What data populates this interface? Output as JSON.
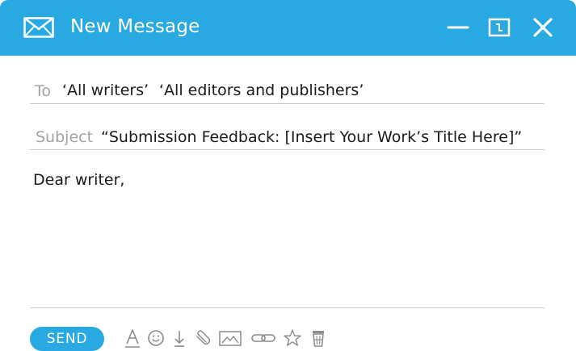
{
  "window": {
    "title": "New Message",
    "icons": [
      "envelope-icon",
      "minimize-icon",
      "maximize-icon",
      "close-icon"
    ]
  },
  "compose": {
    "to_label": "To",
    "recipients": [
      "‘All writers’",
      "‘All editors and publishers’"
    ],
    "subject_label": "Subject",
    "subject_value": "“Submission Feedback: [Insert Your Work’s Title Here]”",
    "body": "Dear writer,"
  },
  "footer": {
    "send_label": "SEND",
    "tools": [
      "text-format-icon",
      "emoji-icon",
      "download-icon",
      "attach-icon",
      "image-icon",
      "link-icon",
      "star-icon",
      "trash-icon"
    ]
  },
  "colors": {
    "accent": "#29a9e1",
    "label_gray": "#a3a3a3",
    "text": "#1a1a1a",
    "rule": "#c9c9c9",
    "icon_gray": "#8a8a8a"
  }
}
